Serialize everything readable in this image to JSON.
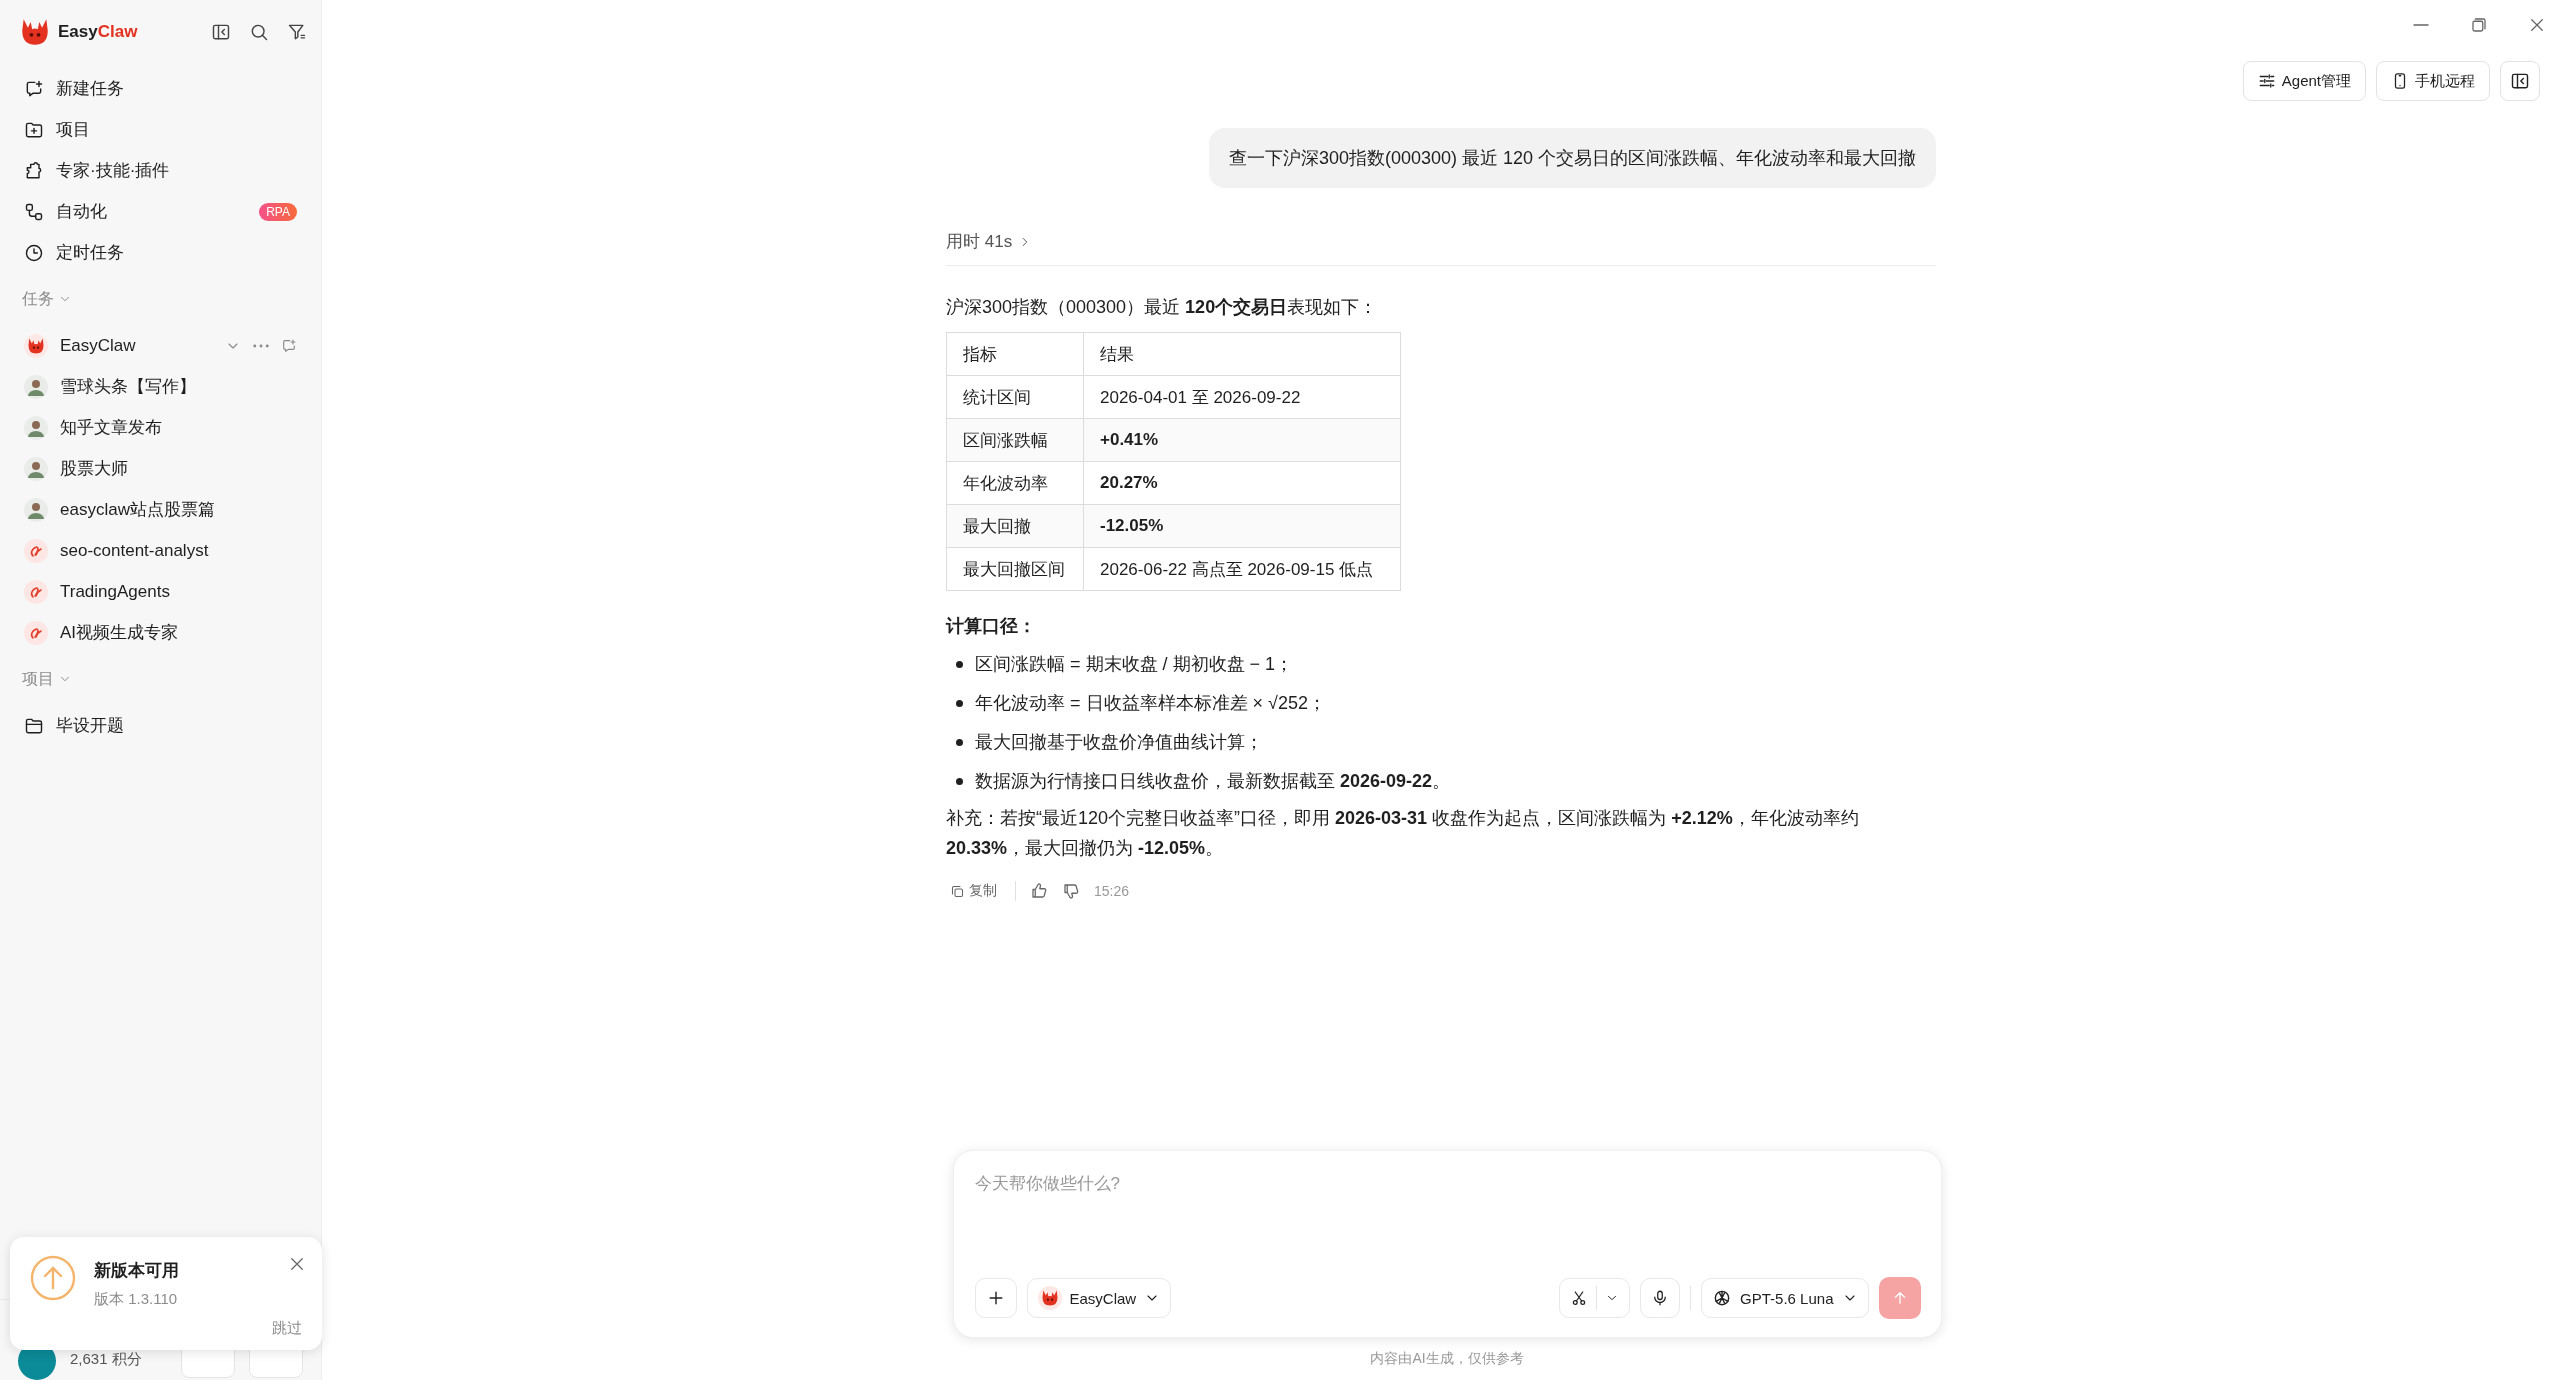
{
  "logo": {
    "brand": "Easy",
    "accent": "Claw"
  },
  "sidebar": {
    "nav": [
      {
        "kind": "new",
        "label": "新建任务"
      },
      {
        "kind": "project",
        "label": "项目"
      },
      {
        "kind": "expert",
        "label": "专家·技能·插件"
      },
      {
        "kind": "flow",
        "label": "自动化",
        "badge": "RPA"
      },
      {
        "kind": "clock",
        "label": "定时任务"
      }
    ],
    "tasks_header": "任务",
    "tasks": [
      {
        "kind": "claw",
        "label": "EasyClaw",
        "hovered": true
      },
      {
        "kind": "person",
        "label": "雪球头条【写作】",
        "hovered": false
      },
      {
        "kind": "person",
        "label": "知乎文章发布",
        "hovered": false
      },
      {
        "kind": "person",
        "label": "股票大师",
        "hovered": false
      },
      {
        "kind": "person",
        "label": "easyclaw站点股票篇",
        "hovered": false
      },
      {
        "kind": "skill",
        "label": "seo-content-analyst",
        "hovered": false
      },
      {
        "kind": "skill",
        "label": "TradingAgents",
        "hovered": false
      },
      {
        "kind": "skill",
        "label": "AI视频生成专家",
        "hovered": false
      }
    ],
    "projects_header": "项目",
    "projects": [
      {
        "label": "毕设开题"
      }
    ],
    "points": "2,631 积分"
  },
  "update_toast": {
    "title": "新版本可用",
    "version": "版本 1.3.110",
    "skip": "跳过"
  },
  "header_buttons": [
    {
      "kind": "agent",
      "label": "Agent管理"
    },
    {
      "kind": "phone",
      "label": "手机远程"
    },
    {
      "kind": "panel"
    }
  ],
  "chat": {
    "user_message": "查一下沪深300指数(000300) 最近 120 个交易日的区间涨跌幅、年化波动率和最大回撤",
    "elapsed": "用时 41s",
    "intro": "沪深300指数（000300）最近 **120个交易日**表现如下：",
    "table": {
      "columns": [
        "指标",
        "结果"
      ],
      "rows": [
        [
          "统计区间",
          "2026-04-01 至 2026-09-22"
        ],
        [
          "区间涨跌幅",
          "**+0.41%**"
        ],
        [
          "年化波动率",
          "**20.27%**"
        ],
        [
          "最大回撤",
          "**-12.05%**"
        ],
        [
          "最大回撤区间",
          "2026-06-22 高点至 2026-09-15 低点"
        ]
      ]
    },
    "method_heading": "计算口径：",
    "bullets": [
      "区间涨跌幅 = 期末收盘 / 期初收盘 − 1；",
      "年化波动率 = 日收益率样本标准差 × √252；",
      "最大回撤基于收盘价净值曲线计算；",
      "数据源为行情接口日线收盘价，最新数据截至 **2026-09-22**。"
    ],
    "note": "补充：若按“最近120个完整日收益率”口径，即用 **2026-03-31** 收盘作为起点，区间涨跌幅为 **+2.12%**，年化波动率约 **20.33%**，最大回撤仍为 **-12.05%**。",
    "actions": {
      "copy": "复制",
      "time": "15:26"
    }
  },
  "composer": {
    "placeholder": "今天帮你做些什么?",
    "agent": "EasyClaw",
    "model": "GPT-5.6 Luna",
    "send_disabled": true
  },
  "footer": "内容由AI生成，仅供参考"
}
